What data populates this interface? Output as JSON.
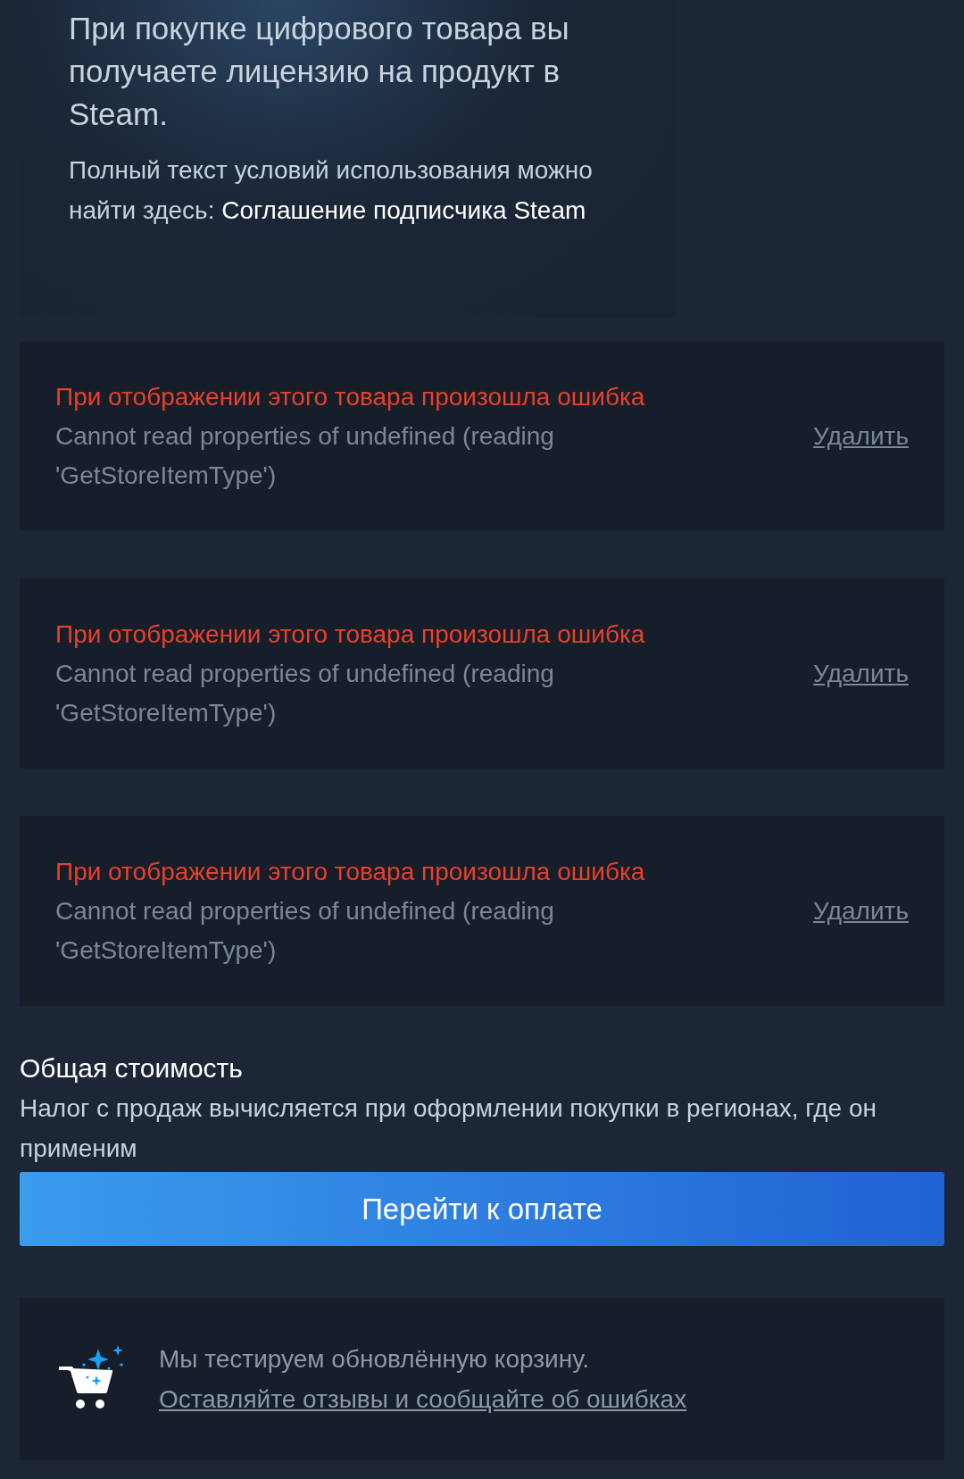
{
  "license_card": {
    "heading": "При покупке цифрового товара вы получаете лицензию на продукт в Steam.",
    "text": "Полный текст условий использования можно найти здесь:",
    "link": "Соглашение подписчика Steam"
  },
  "cart_items": [
    {
      "kind": "error",
      "title": "При отображении этого товара произошла ошибка",
      "message": "Cannot read properties of undefined (reading 'GetStoreItemType')",
      "remove": "Удалить"
    },
    {
      "kind": "error",
      "title": "При отображении этого товара произошла ошибка",
      "message": "Cannot read properties of undefined (reading 'GetStoreItemType')",
      "remove": "Удалить"
    },
    {
      "kind": "error",
      "title": "При отображении этого товара произошла ошибка",
      "message": "Cannot read properties of undefined (reading 'GetStoreItemType')",
      "remove": "Удалить"
    }
  ],
  "total": {
    "label": "Общая стоимость",
    "tax_note": "Налог с продаж вычисляется при оформлении покупки в регионах, где он применим",
    "checkout_button": "Перейти к оплате"
  },
  "beta_banner": {
    "text": "Мы тестируем обновлённую корзину.",
    "link": "Оставляйте отзывы и сообщайте об ошибках"
  }
}
